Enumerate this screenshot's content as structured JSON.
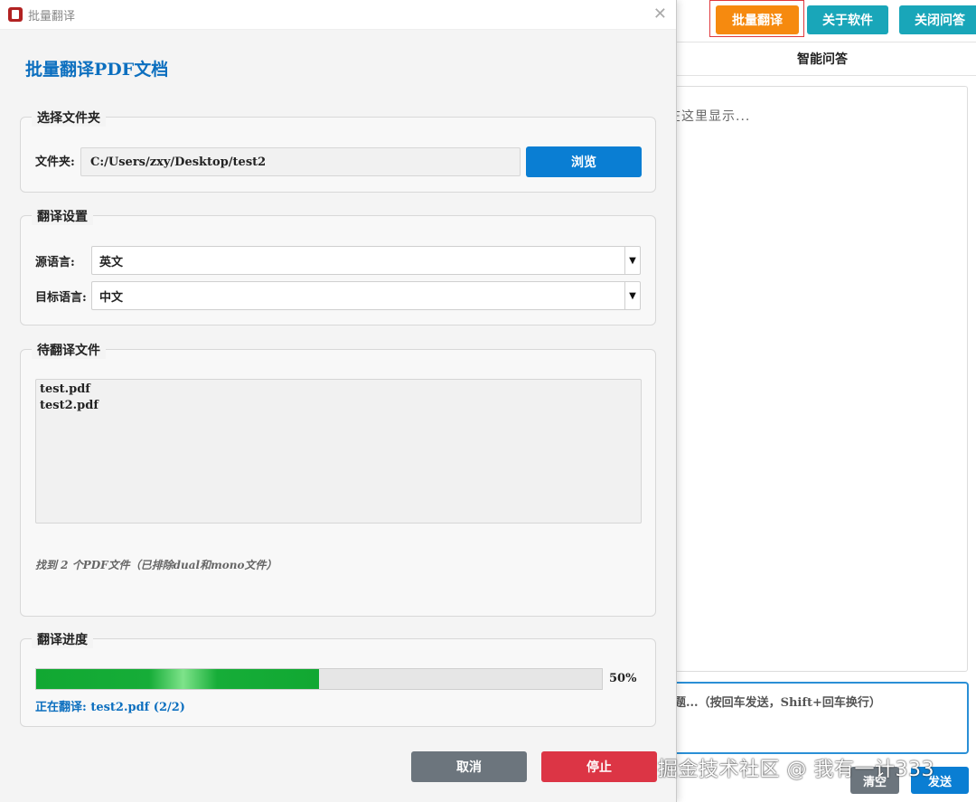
{
  "background_app": {
    "top_buttons": {
      "batch_translate": "批量翻译",
      "about": "关于软件",
      "close_qa": "关闭问答"
    },
    "qa_title": "智能问答",
    "qa_output_placeholder": "在这里显示...",
    "qa_input_placeholder": "题...（按回车发送，Shift+回车换行）",
    "clear_label": "清空",
    "send_label": "发送",
    "watermark": "掘金技术社区 @ 我有一计333"
  },
  "dialog": {
    "window_title": "批量翻译",
    "heading": "批量翻译PDF文档",
    "folder_group": {
      "title": "选择文件夹",
      "folder_label": "文件夹:",
      "folder_value": "C:/Users/zxy/Desktop/test2",
      "browse_label": "浏览"
    },
    "settings_group": {
      "title": "翻译设置",
      "source_label": "源语言:",
      "source_value": "英文",
      "target_label": "目标语言:",
      "target_value": "中文"
    },
    "files_group": {
      "title": "待翻译文件",
      "files": [
        "test.pdf",
        "test2.pdf"
      ],
      "found_text": "找到 2 个PDF文件（已排除dual和mono文件）"
    },
    "progress_group": {
      "title": "翻译进度",
      "percent": 50,
      "percent_label": "50%",
      "status": "正在翻译: test2.pdf (2/2)"
    },
    "cancel_label": "取消",
    "stop_label": "停止"
  },
  "colors": {
    "accent_blue": "#0a7ed3",
    "orange": "#f68a0f",
    "teal": "#19a6b9",
    "stop_red": "#dc3545",
    "cancel_gray": "#6c757d",
    "progress_green": "#11a832"
  }
}
